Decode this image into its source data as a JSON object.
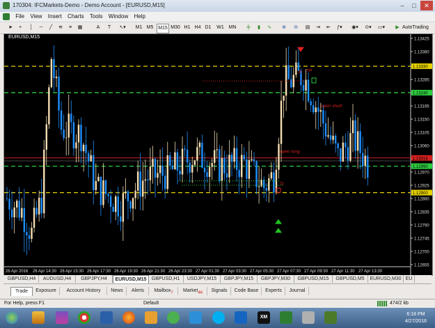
{
  "window": {
    "title": "170304: IFCMarkets-Demo - Demo Account - [EURUSD,M15]",
    "minimize": "–",
    "restore": "□",
    "close": "✕"
  },
  "menu": [
    "File",
    "View",
    "Insert",
    "Charts",
    "Tools",
    "Window",
    "Help"
  ],
  "toolbar": {
    "text_tool": "A",
    "label_tool": "T",
    "timeframes": [
      "M1",
      "M5",
      "M15",
      "M30",
      "H1",
      "H4",
      "D1",
      "W1",
      "MN"
    ],
    "autotrading": "AutoTrading"
  },
  "chart": {
    "label": "EURUSD,M15",
    "price_levels": [
      "1.13425",
      "1.13380",
      "1.13330",
      "1.13285",
      "1.13240",
      "1.13195",
      "1.13150",
      "1.13105",
      "1.13060",
      "1.13015",
      "1.12970",
      "1.12925",
      "1.12880",
      "1.12835",
      "1.12790",
      "1.12745",
      "1.12700",
      "1.12655"
    ],
    "markers": [
      "1.13330",
      "1.13240",
      "1.13018",
      "1.12990",
      "1.12900"
    ],
    "time_labels": [
      "26 Apr 2016",
      "26 Apr 14:30",
      "26 Apr 15:30",
      "26 Apr 17:30",
      "26 Apr 19:30",
      "26 Apr 21:30",
      "26 Apr 23:30",
      "27 Apr 01:30",
      "27 Apr 03:30",
      "27 Apr 05:30",
      "27 Apr 07:30",
      "27 Apr 09:30",
      "27 Apr 11:30",
      "27 Apr 13:30"
    ],
    "annotations": {
      "open_long": "open long",
      "open_short": "open short",
      "tp_label": "R",
      "sl_label": "TP",
      "entry_label": "Tr"
    },
    "colors": {
      "bull": "#f5deb3",
      "bear": "#1e90ff",
      "yellow_line": "#e6d200",
      "green_line": "#2ecc40",
      "red_line": "#d42020"
    }
  },
  "chart_tabs": [
    "GBPUSD,H4",
    "AUDUSD,H4",
    "GBPJPY,H4",
    "EURUSD,M15",
    "GBPUSD,H1",
    "USDJPY,M15",
    "GBPJPY,M15",
    "GBPJPY,M30",
    "GBPUSD,M15",
    "GBPUSD,M5",
    "EURUSD,M30",
    "EU"
  ],
  "terminal_tabs": [
    "Trade",
    "Exposure",
    "Account History",
    "News",
    "Alerts",
    "Mailbox",
    "Market",
    "Signals",
    "Code Base",
    "Experts",
    "Journal"
  ],
  "terminal_counts": {
    "mailbox": "7",
    "market": "46"
  },
  "status": {
    "help": "For Help, press F1",
    "profile": "Default",
    "traffic": "474/2 kb"
  },
  "clock": {
    "time": "6:18 PM",
    "date": "4/27/2016"
  }
}
